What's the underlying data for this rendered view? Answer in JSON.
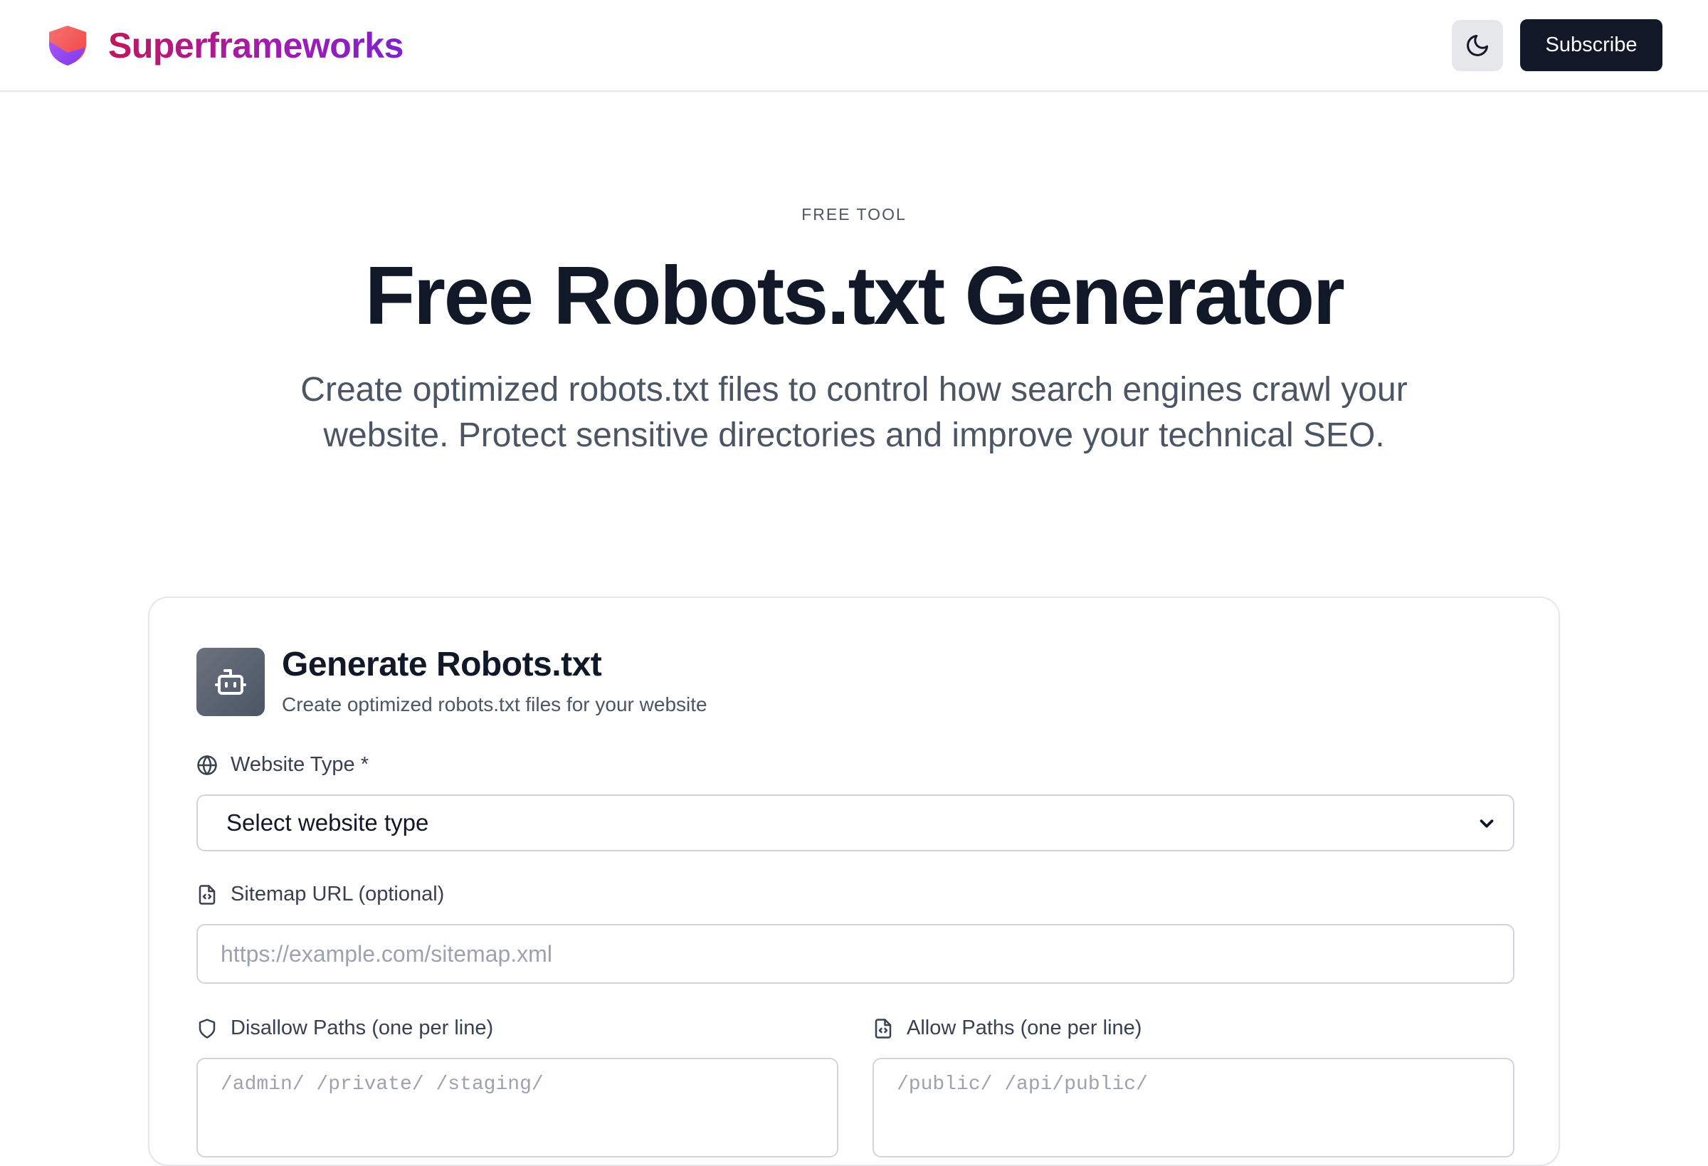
{
  "header": {
    "brand_name": "Superframeworks",
    "subscribe_label": "Subscribe"
  },
  "hero": {
    "eyebrow": "FREE TOOL",
    "title": "Free Robots.txt Generator",
    "subtitle": "Create optimized robots.txt files to control how search engines crawl your website. Protect sensitive directories and improve your technical SEO."
  },
  "card": {
    "title": "Generate Robots.txt",
    "subtitle": "Create optimized robots.txt files for your website",
    "website_type": {
      "label": "Website Type *",
      "selected": "Select website type"
    },
    "sitemap": {
      "label": "Sitemap URL (optional)",
      "value": "",
      "placeholder": "https://example.com/sitemap.xml"
    },
    "disallow": {
      "label": "Disallow Paths (one per line)",
      "placeholder": "/admin/ /private/ /staging/"
    },
    "allow": {
      "label": "Allow Paths (one per line)",
      "placeholder": "/public/ /api/public/"
    }
  },
  "colors": {
    "brand_gradient_start": "#be185d",
    "brand_gradient_end": "#7e22ce",
    "primary_button": "#111827",
    "card_icon_bg": "#4b5563"
  },
  "icons": {
    "brand": "shield-logo-icon",
    "theme": "moon-icon",
    "card": "bot-icon",
    "website_type": "globe-icon",
    "sitemap": "file-code-icon",
    "disallow": "shield-icon",
    "allow": "file-code-icon",
    "select": "chevron-down-icon"
  }
}
